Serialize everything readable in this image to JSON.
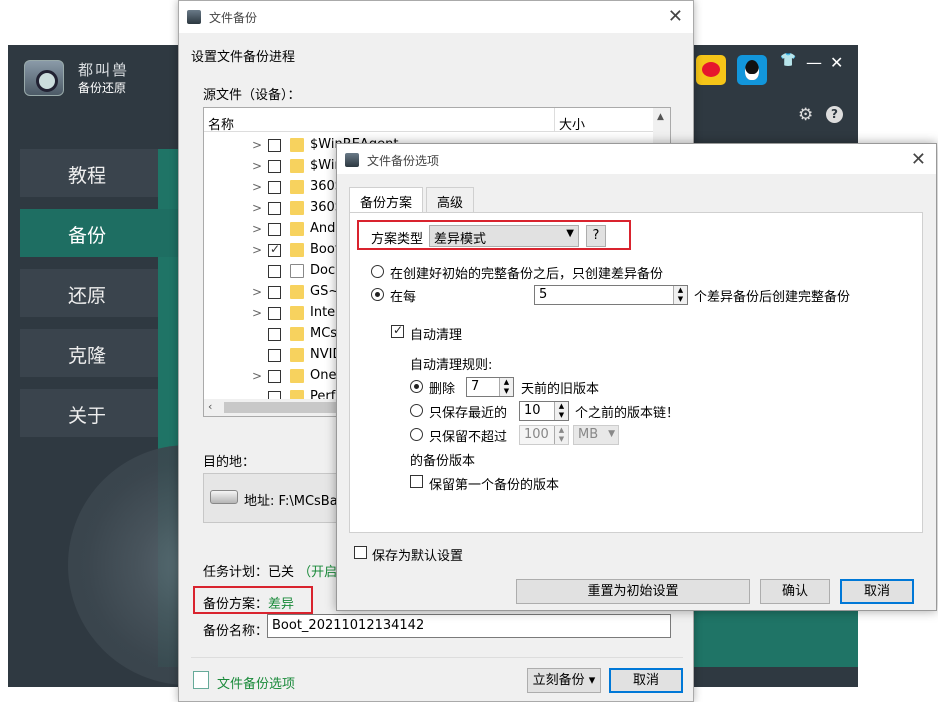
{
  "main_app": {
    "brand_line1": "都叫兽",
    "brand_line2": "备份还原",
    "nav": [
      "教程",
      "备份",
      "还原",
      "克隆",
      "关于"
    ],
    "active_nav": "备份",
    "minimize": "—",
    "close": "✕",
    "help": "?"
  },
  "backup_dialog": {
    "title": "文件备份",
    "close": "✕",
    "subtitle": "设置文件备份进程",
    "source_label": "源文件（设备）：",
    "columns": {
      "name": "名称",
      "size": "大小"
    },
    "tree_items": [
      {
        "name": "$WinREAgent",
        "checked": false,
        "expandable": true
      },
      {
        "name": "$Win",
        "checked": false,
        "expandable": true
      },
      {
        "name": "360S",
        "checked": false,
        "expandable": true
      },
      {
        "name": "360S",
        "checked": false,
        "expandable": true
      },
      {
        "name": "Andr",
        "checked": false,
        "expandable": true
      },
      {
        "name": "Boot",
        "checked": true,
        "expandable": true
      },
      {
        "name": "Docu",
        "checked": false,
        "expandable": false
      },
      {
        "name": "GS~U",
        "checked": false,
        "expandable": true
      },
      {
        "name": "Intel",
        "checked": false,
        "expandable": true
      },
      {
        "name": "MCsB",
        "checked": false,
        "expandable": false
      },
      {
        "name": "NVID",
        "checked": false,
        "expandable": false
      },
      {
        "name": "OneD",
        "checked": false,
        "expandable": true
      },
      {
        "name": "PerfL",
        "checked": false,
        "expandable": false
      }
    ],
    "dest_label": "目的地：",
    "dest_address": "地址: F:\\MCsBac",
    "schedule_label": "任务计划：已关",
    "schedule_action": "（开启",
    "scheme_label": "备份方案：",
    "scheme_value": "差异",
    "name_label": "备份名称：",
    "name_value": "Boot_20211012134142",
    "options_link": "文件备份选项",
    "backup_now": "立刻备份 ▾",
    "cancel": "取消"
  },
  "options_dialog": {
    "title": "文件备份选项",
    "close": "✕",
    "tabs": [
      "备份方案",
      "高级"
    ],
    "scheme_type_label": "方案类型",
    "scheme_type_value": "差异模式",
    "scheme_help": "?",
    "radio1": "在创建好初始的完整备份之后，只创建差异备份",
    "radio2": "在每",
    "every_value": "5",
    "every_suffix": "个差异备份后创建完整备份",
    "auto_clean": "自动清理",
    "rules_label": "自动清理规则:",
    "delete_label": "删除",
    "delete_days": "7",
    "delete_suffix": "天前的旧版本",
    "keep_latest_label": "只保存最近的",
    "keep_latest_value": "10",
    "keep_latest_suffix": "个之前的版本链！",
    "keep_max_label": "只保留不超过",
    "keep_max_value": "100",
    "keep_max_unit": "MB",
    "keep_max_suffix": "的备份版本",
    "keep_first": "保留第一个备份的版本",
    "save_default": "保存为默认设置",
    "reset": "重置为初始设置",
    "ok": "确认",
    "cancel": "取消"
  },
  "colors": {
    "accent_teal": "#1f7466",
    "highlight_red": "#d9232e",
    "link_green": "#1a8a3a",
    "focus_blue": "#0078d7"
  }
}
